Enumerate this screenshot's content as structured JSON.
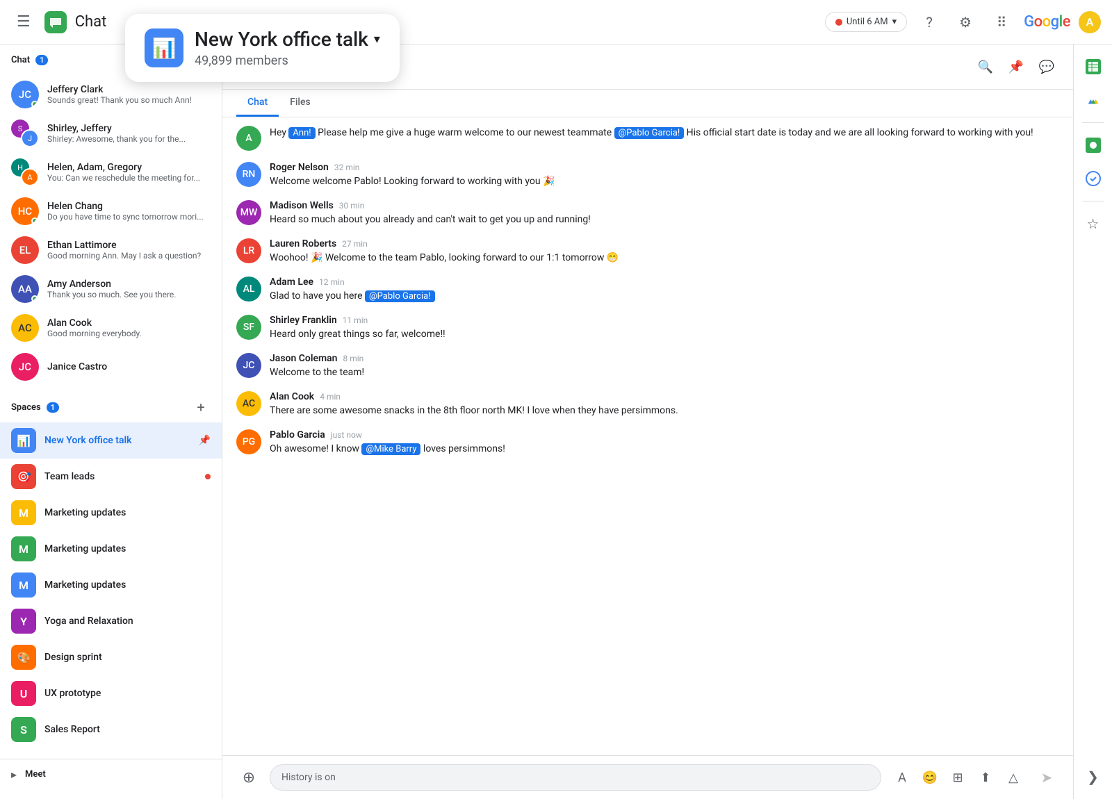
{
  "topbar": {
    "hamburger": "☰",
    "title": "Chat",
    "status": "Until 6 AM",
    "help": "?",
    "settings": "⚙",
    "apps": "⠿",
    "google_logo": "Google"
  },
  "tooltip": {
    "name": "New York office talk",
    "members": "49,899 members",
    "dropdown_label": "▾"
  },
  "sidebar": {
    "chat_section": "Chat",
    "chat_badge": "1",
    "spaces_section": "Spaces",
    "spaces_badge": "1",
    "meet_section": "Meet",
    "chats": [
      {
        "name": "Jeffery Clark",
        "preview": "Sounds great! Thank you so much Ann!",
        "online": true,
        "color": "av-blue",
        "initials": "JC"
      },
      {
        "name": "Shirley, Jeffery",
        "preview": "Shirley: Awesome, thank you for the...",
        "online": false,
        "color": "av-purple",
        "initials": "SJ",
        "group": true
      },
      {
        "name": "Helen, Adam, Gregory",
        "preview": "You: Can we reschedule the meeting for...",
        "online": false,
        "color": "av-teal",
        "initials": "H",
        "group": true
      },
      {
        "name": "Helen Chang",
        "preview": "Do you have time to sync tomorrow mori...",
        "online": true,
        "color": "av-orange",
        "initials": "HC"
      },
      {
        "name": "Ethan Lattimore",
        "preview": "Good morning Ann. May I ask a question?",
        "online": false,
        "color": "av-red",
        "initials": "EL"
      },
      {
        "name": "Amy Anderson",
        "preview": "Thank you so much. See you there.",
        "online": true,
        "color": "av-indigo",
        "initials": "AA"
      },
      {
        "name": "Alan Cook",
        "preview": "Good morning everybody.",
        "online": false,
        "color": "av-yellow",
        "initials": "AC"
      },
      {
        "name": "Janice Castro",
        "preview": "",
        "online": false,
        "color": "av-pink",
        "initials": "JC"
      }
    ],
    "spaces": [
      {
        "name": "New York office talk",
        "icon": "📊",
        "color": "#4285f4",
        "active": true,
        "pinned": true
      },
      {
        "name": "Team leads",
        "icon": "🎯",
        "color": "#ea4335",
        "active": false,
        "unread": true
      },
      {
        "name": "Marketing updates",
        "icon": "M",
        "color": "#fbbc05",
        "active": false
      },
      {
        "name": "Marketing updates",
        "icon": "M",
        "color": "#34a853",
        "active": false
      },
      {
        "name": "Marketing updates",
        "icon": "M",
        "color": "#4285f4",
        "active": false
      },
      {
        "name": "Yoga and Relaxation",
        "icon": "Y",
        "color": "#9c27b0",
        "active": false
      },
      {
        "name": "Design sprint",
        "icon": "🎨",
        "color": "#ff6d00",
        "active": false
      },
      {
        "name": "UX prototype",
        "icon": "U",
        "color": "#e91e63",
        "active": false
      },
      {
        "name": "Sales Report",
        "icon": "S",
        "color": "#34a853",
        "active": false
      }
    ]
  },
  "chat_header": {
    "name": "New York office talk",
    "members": "49,899 members",
    "tab_chat": "Chat",
    "tab_files": "Files"
  },
  "messages": [
    {
      "name": "Roger Nelson",
      "time": "32 min",
      "text": "Welcome welcome Pablo! Looking forward to working with you 🎉",
      "color": "av-blue",
      "initials": "RN"
    },
    {
      "name": "Madison Wells",
      "time": "30 min",
      "text": "Heard so much about you already and can't wait to get you up and running!",
      "color": "av-purple",
      "initials": "MW"
    },
    {
      "name": "Lauren Roberts",
      "time": "27 min",
      "text": "Woohoo! 🎉 Welcome to the team Pablo, looking forward to our 1:1 tomorrow 😁",
      "color": "av-red",
      "initials": "LR"
    },
    {
      "name": "Adam Lee",
      "time": "12 min",
      "text": "Glad to have you here ",
      "mention": "@Pablo Garcia!",
      "color": "av-teal",
      "initials": "AL"
    },
    {
      "name": "Shirley Franklin",
      "time": "11 min",
      "text": "Heard only great things so far, welcome!!",
      "color": "av-green",
      "initials": "SF"
    },
    {
      "name": "Jason Coleman",
      "time": "8 min",
      "text": "Welcome to the team!",
      "color": "av-indigo",
      "initials": "JC"
    },
    {
      "name": "Alan Cook",
      "time": "4 min",
      "text": "There are some awesome snacks in the 8th floor north MK! I love when they have persimmons.",
      "color": "av-yellow",
      "initials": "AC"
    },
    {
      "name": "Pablo Garcia",
      "time": "just now",
      "text": "Oh awesome! I know ",
      "mention": "@Mike Barry",
      "text_after": " loves persimmons!",
      "color": "av-orange",
      "initials": "PG"
    }
  ],
  "input": {
    "placeholder": "History is on"
  },
  "right_sidebar": {
    "icons": [
      "sheets",
      "drive",
      "meet",
      "tasks",
      "star"
    ]
  }
}
